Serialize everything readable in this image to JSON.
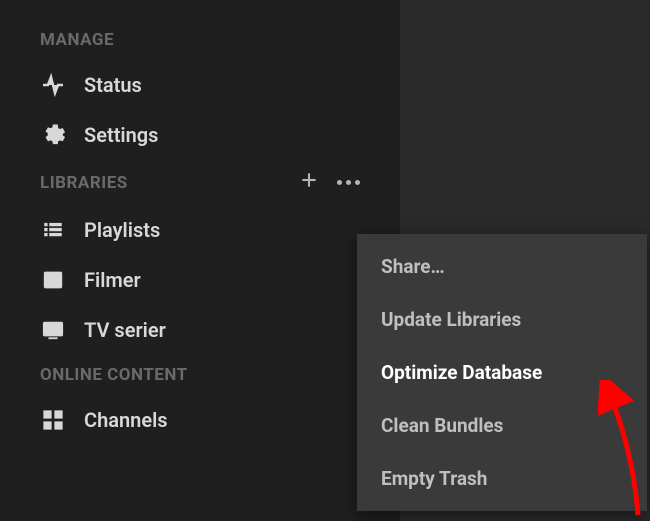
{
  "sidebar": {
    "manage": {
      "header": "MANAGE",
      "items": [
        {
          "label": "Status"
        },
        {
          "label": "Settings"
        }
      ]
    },
    "libraries": {
      "header": "LIBRARIES",
      "items": [
        {
          "label": "Playlists"
        },
        {
          "label": "Filmer"
        },
        {
          "label": "TV serier"
        }
      ]
    },
    "online": {
      "header": "ONLINE CONTENT",
      "items": [
        {
          "label": "Channels"
        }
      ]
    }
  },
  "context_menu": {
    "items": [
      {
        "label": "Share…"
      },
      {
        "label": "Update Libraries"
      },
      {
        "label": "Optimize Database"
      },
      {
        "label": "Clean Bundles"
      },
      {
        "label": "Empty Trash"
      }
    ]
  }
}
